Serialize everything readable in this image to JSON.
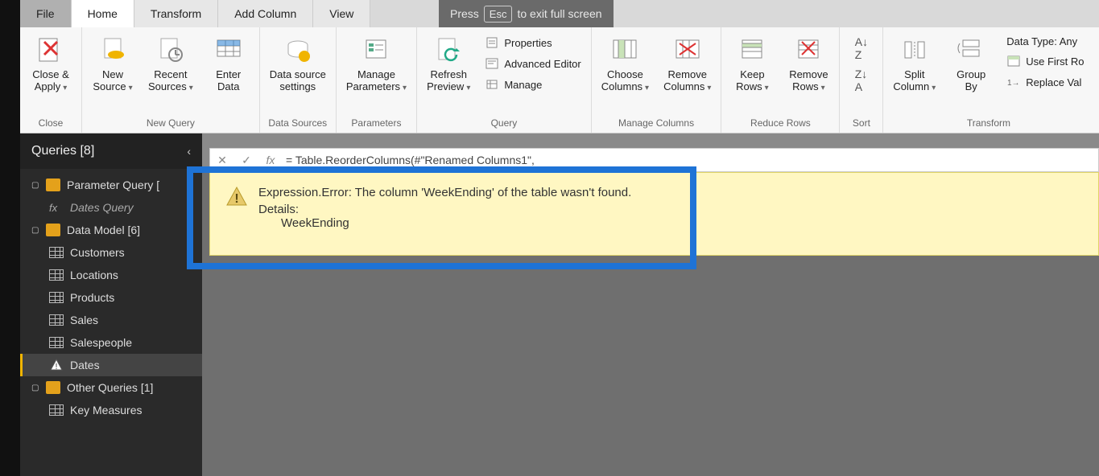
{
  "fsnotice": {
    "pre": "Press",
    "key": "Esc",
    "post": "to exit full screen"
  },
  "tabs": {
    "file": "File",
    "home": "Home",
    "transform": "Transform",
    "addcol": "Add Column",
    "view": "View"
  },
  "ribbon": {
    "close": {
      "label": "Close &\nApply",
      "group": "Close"
    },
    "newq": {
      "newsrc": "New\nSource",
      "recent": "Recent\nSources",
      "enter": "Enter\nData",
      "group": "New Query"
    },
    "ds": {
      "label": "Data source\nsettings",
      "group": "Data Sources"
    },
    "params": {
      "label": "Manage\nParameters",
      "group": "Parameters"
    },
    "query": {
      "refresh": "Refresh\nPreview",
      "props": "Properties",
      "adv": "Advanced Editor",
      "manage": "Manage",
      "group": "Query"
    },
    "mcols": {
      "choose": "Choose\nColumns",
      "remove": "Remove\nColumns",
      "group": "Manage Columns"
    },
    "rrows": {
      "keep": "Keep\nRows",
      "remove": "Remove\nRows",
      "group": "Reduce Rows"
    },
    "sort": {
      "group": "Sort"
    },
    "transform": {
      "split": "Split\nColumn",
      "group_by": "Group\nBy",
      "dtype": "Data Type: Any",
      "firstrow": "Use First Ro",
      "replace": "Replace Val",
      "group": "Transform"
    }
  },
  "queries": {
    "header": "Queries [8]",
    "g1": "Parameter Query [",
    "g1a": "Dates Query",
    "g2": "Data Model [6]",
    "items": [
      "Customers",
      "Locations",
      "Products",
      "Sales",
      "Salespeople",
      "Dates"
    ],
    "g3": "Other Queries [1]",
    "g3a": "Key Measures"
  },
  "formula": "= Table.ReorderColumns(#\"Renamed Columns1\",",
  "error": {
    "title": "Expression.Error: The column 'WeekEnding' of the table wasn't found.",
    "details_label": "Details:",
    "details_value": "WeekEnding"
  }
}
